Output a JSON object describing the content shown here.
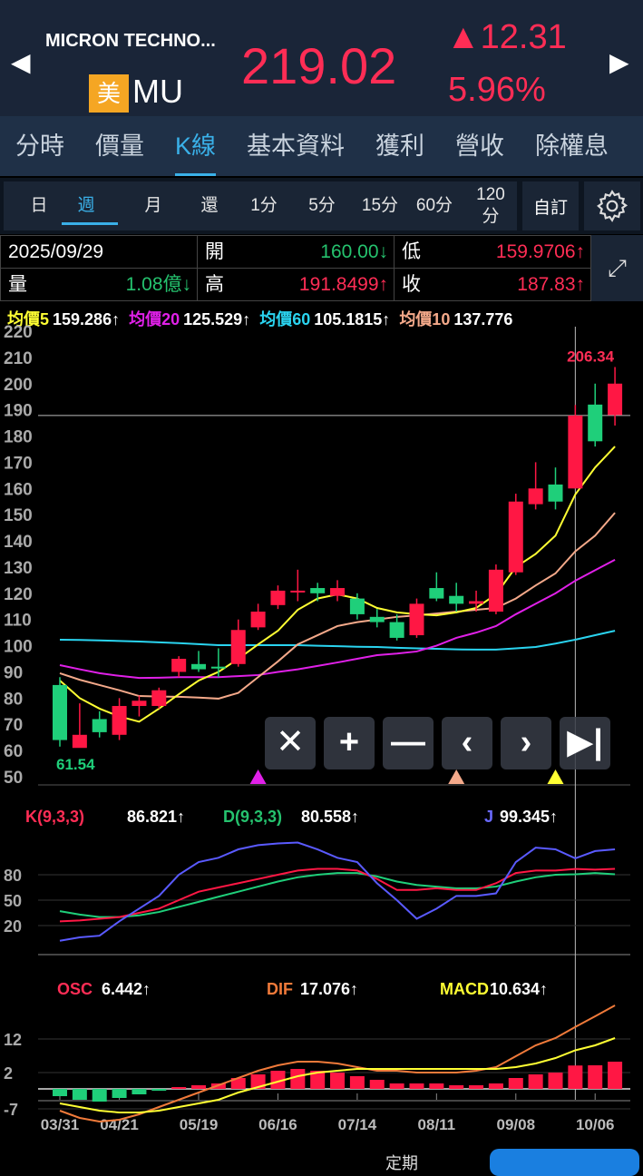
{
  "header": {
    "name": "MICRON TECHNO...",
    "market_badge": "美",
    "symbol": "MU",
    "price": "219.02",
    "change": "12.31",
    "change_pct": "5.96%",
    "up_color": "#ff2d55"
  },
  "tabs": [
    {
      "label": "分時"
    },
    {
      "label": "價量"
    },
    {
      "label": "K線",
      "active": true
    },
    {
      "label": "基本資料"
    },
    {
      "label": "獲利"
    },
    {
      "label": "營收"
    },
    {
      "label": "除權息"
    }
  ],
  "periods": [
    {
      "label": "日"
    },
    {
      "label": "週",
      "active": true
    },
    {
      "label": "月"
    },
    {
      "label": "還"
    },
    {
      "label": "1分"
    },
    {
      "label": "5分"
    },
    {
      "label": "15分"
    },
    {
      "label": "60分"
    },
    {
      "label": "120\n分"
    }
  ],
  "custom_label": "自訂",
  "info": {
    "date": "2025/09/29",
    "open_label": "開",
    "open": "160.00↓",
    "low_label": "低",
    "low": "159.9706↑",
    "vol_label": "量",
    "vol": "1.08億↓",
    "high_label": "高",
    "high": "191.8499↑",
    "close_label": "收",
    "close": "187.83↑"
  },
  "ma_legend": [
    {
      "label": "均價5",
      "value": "159.286↑",
      "color": "#ffff33"
    },
    {
      "label": "均價20",
      "value": "125.529↑",
      "color": "#e020e8"
    },
    {
      "label": "均價60",
      "value": "105.1815↑",
      "color": "#2ad4f0"
    },
    {
      "label": "均價10",
      "value": "137.776",
      "color": "#f4a98a"
    }
  ],
  "kdj_legend": {
    "k": "K(9,3,3)",
    "kv": "86.821↑",
    "d": "D(9,3,3)",
    "dv": "80.558↑",
    "j": "J",
    "jv": "99.345↑"
  },
  "macd_legend": {
    "osc": "OSC",
    "oscv": "6.442↑",
    "dif": "DIF",
    "difv": "17.076↑",
    "macd": "MACD",
    "macdv": "10.634↑"
  },
  "controls": [
    "✕",
    "+",
    "—",
    "‹",
    "›",
    "▶|"
  ],
  "bottom_nav": {
    "partial_label": "定期"
  },
  "chart_data": [
    {
      "type": "candlestick",
      "title": "MU weekly",
      "ylim": [
        50,
        220
      ],
      "yticks": [
        220,
        210,
        200,
        190,
        180,
        170,
        160,
        150,
        140,
        130,
        120,
        110,
        100,
        90,
        80,
        70,
        60,
        50
      ],
      "xticks": [
        "03/31",
        "04/21",
        "05/19",
        "06/16",
        "07/14",
        "08/11",
        "09/08",
        "10/06"
      ],
      "xtick_index": [
        0,
        3,
        7,
        11,
        15,
        19,
        23,
        27
      ],
      "max_label": "206.34",
      "min_label": "61.54",
      "selected_index": 26,
      "candles": [
        [
          85,
          88,
          61.5,
          64
        ],
        [
          61,
          78,
          61.54,
          66
        ],
        [
          72,
          75,
          65,
          67
        ],
        [
          66,
          80,
          64,
          77
        ],
        [
          77,
          81,
          73,
          79
        ],
        [
          77,
          84,
          76,
          83
        ],
        [
          90,
          96,
          88,
          95
        ],
        [
          93,
          98,
          90,
          91
        ],
        [
          92,
          99,
          88,
          91.5
        ],
        [
          93,
          110,
          92,
          106
        ],
        [
          107,
          116,
          106,
          113
        ],
        [
          115.5,
          123,
          114,
          121
        ],
        [
          120.5,
          129,
          117,
          121
        ],
        [
          122,
          124,
          117,
          120
        ],
        [
          119,
          125,
          117,
          122
        ],
        [
          118,
          120,
          110,
          112
        ],
        [
          111,
          114,
          107,
          109
        ],
        [
          109,
          112,
          102,
          103
        ],
        [
          104,
          118,
          103,
          116
        ],
        [
          122,
          128,
          117,
          118
        ],
        [
          119,
          124,
          113,
          116
        ],
        [
          116,
          121,
          113,
          117
        ],
        [
          113,
          131,
          112,
          129
        ],
        [
          128,
          158,
          127,
          155
        ],
        [
          154,
          170,
          152,
          160
        ],
        [
          161.5,
          168,
          152,
          155
        ],
        [
          160,
          191.8499,
          159.9706,
          187.83
        ],
        [
          192,
          200,
          176,
          178
        ],
        [
          188,
          206.34,
          184,
          200
        ]
      ],
      "ma5": [
        86.7,
        80,
        76,
        73,
        71,
        76,
        81.5,
        86.7,
        90,
        95,
        100.5,
        105.7,
        113.7,
        118,
        119.6,
        118,
        114.4,
        112.7,
        112,
        111.6,
        112.7,
        114.4,
        119.6,
        130,
        135,
        142,
        157.7,
        168,
        176
      ],
      "ma10": [
        89.5,
        87,
        85,
        83,
        80.8,
        80.6,
        80.5,
        80.2,
        79.8,
        82,
        88,
        94,
        100.5,
        104,
        107.5,
        109,
        110,
        111,
        111.6,
        112.3,
        113,
        113.7,
        114.4,
        118,
        123,
        127.6,
        136,
        142,
        150.7
      ],
      "ma20": [
        92.6,
        91,
        89.5,
        88.5,
        87.7,
        87.8,
        88,
        88,
        88,
        88.4,
        88.8,
        90,
        91,
        92.3,
        93.6,
        95,
        96.4,
        97,
        97.8,
        100,
        103,
        105,
        107.5,
        112,
        116,
        120,
        124.8,
        128.8,
        132.8
      ],
      "ma60": [
        102.3,
        102.2,
        102,
        101.8,
        101.6,
        101.3,
        101,
        100.6,
        100.2,
        100.2,
        100.2,
        100.2,
        100.2,
        100,
        99.8,
        99.6,
        99.5,
        99.2,
        99,
        98.8,
        98.6,
        98.5,
        98.5,
        99,
        99.5,
        100.8,
        102.3,
        104,
        105.7
      ],
      "markers": [
        {
          "index": 10,
          "color": "#e020e8"
        },
        {
          "index": 20,
          "color": "#f4a98a"
        },
        {
          "index": 25,
          "color": "#ffff33"
        }
      ]
    },
    {
      "type": "line",
      "title": "KDJ",
      "ylim": [
        -14,
        116
      ],
      "yticks": [
        80,
        50,
        20
      ],
      "K": [
        25,
        26,
        28,
        30,
        35,
        40,
        50,
        60,
        65,
        70,
        75,
        80,
        85,
        87,
        87,
        85,
        75,
        62,
        62,
        64,
        62,
        62,
        70,
        82,
        85,
        85,
        86.821,
        86,
        87
      ],
      "D": [
        37,
        33,
        30,
        30,
        32,
        36,
        42,
        48,
        54,
        60,
        66,
        72,
        77,
        80,
        82,
        82,
        78,
        72,
        68,
        66,
        64,
        64,
        66,
        72,
        77,
        80,
        80.558,
        82,
        80.6
      ],
      "J": [
        2,
        6,
        8,
        25,
        40,
        55,
        80,
        95,
        100,
        110,
        115,
        117,
        118,
        110,
        100,
        95,
        70,
        50,
        28,
        40,
        55,
        55,
        58,
        95,
        112,
        110,
        99.345,
        108,
        110
      ]
    },
    {
      "type": "bar+line",
      "title": "MACD",
      "ylim": [
        -9,
        22
      ],
      "yticks": [
        12,
        2,
        -7
      ],
      "OSC": [
        -2,
        -3,
        -3.5,
        -2.5,
        -1.5,
        -0.5,
        0.5,
        1,
        1.5,
        3,
        4,
        5,
        5.5,
        5,
        4.5,
        3.5,
        2.5,
        1.5,
        1.5,
        1.5,
        1,
        1,
        1.5,
        3,
        4,
        4.5,
        6.442,
        6.5,
        7.5
      ],
      "DIF": [
        -6,
        -8,
        -9,
        -8.5,
        -7,
        -5,
        -3,
        -1,
        1,
        3,
        5,
        6.5,
        7.5,
        7.5,
        7,
        6,
        5,
        5,
        4.5,
        4.5,
        4.5,
        5,
        6,
        9,
        12,
        14,
        17.076,
        20,
        23
      ],
      "MACD": [
        -4,
        -5,
        -6,
        -6.5,
        -6.5,
        -6,
        -5,
        -4,
        -3,
        -1,
        0.5,
        2,
        3.5,
        4.5,
        5,
        5.5,
        5.5,
        5.5,
        5.5,
        5.5,
        5.5,
        5.5,
        5.5,
        6,
        7,
        8.5,
        10.634,
        12,
        14
      ]
    }
  ]
}
